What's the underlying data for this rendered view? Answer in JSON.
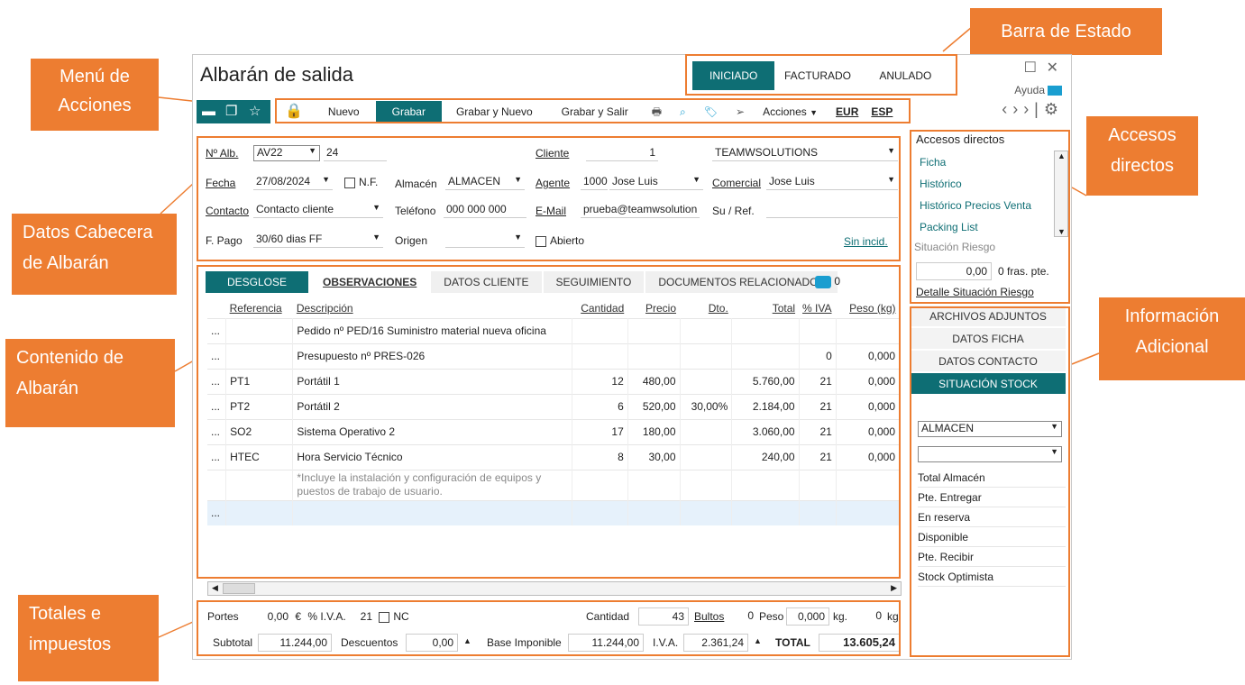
{
  "callouts": {
    "status_bar": "Barra de Estado",
    "actions_menu": "Menú de Acciones",
    "header_data": "Datos Cabecera de Albarán",
    "content": "Contenido de Albarán",
    "totals": "Totales e impuestos",
    "shortcuts": "Accesos directos",
    "extra_info": "Información Adicional"
  },
  "window": {
    "title": "Albarán de salida",
    "help": "Ayuda",
    "minimize": "☐",
    "close": "✕"
  },
  "status": {
    "items": [
      "INICIADO",
      "FACTURADO",
      "ANULADO"
    ]
  },
  "actions": {
    "nuevo": "Nuevo",
    "grabar": "Grabar",
    "grabar_nuevo": "Grabar y Nuevo",
    "grabar_salir": "Grabar y Salir",
    "acciones": "Acciones",
    "currency": "EUR",
    "lang": "ESP"
  },
  "header": {
    "albaran_label": "Nº Alb.",
    "serie": "AV22",
    "numero": "24",
    "fecha_label": "Fecha",
    "fecha": "27/08/2024",
    "nf_label": "N.F.",
    "almacen_label": "Almacén",
    "almacen": "ALMACEN",
    "contacto_label": "Contacto",
    "contacto": "Contacto cliente",
    "telefono_label": "Teléfono",
    "telefono": "000 000 000",
    "fpago_label": "F. Pago",
    "fpago": "30/60 dias FF",
    "origen_label": "Origen",
    "cliente_label": "Cliente",
    "cliente_code": "1",
    "cliente_name": "TEAMWSOLUTIONS",
    "agente_label": "Agente",
    "agente_code": "1000",
    "agente_name": "Jose Luis",
    "comercial_label": "Comercial",
    "comercial_name": "Jose Luis",
    "email_label": "E-Mail",
    "email": "prueba@teamwsolution",
    "suref_label": "Su / Ref.",
    "abierto_label": "Abierto",
    "sin_incid": "Sin incid."
  },
  "tabs": [
    "DESGLOSE",
    "OBSERVACIONES",
    "DATOS CLIENTE",
    "SEGUIMIENTO",
    "DOCUMENTOS RELACIONADOS"
  ],
  "comments_count": "0",
  "grid": {
    "columns": [
      "Referencia",
      "Descripción",
      "Cantidad",
      "Precio",
      "Dto.",
      "Total",
      "% IVA",
      "Peso (kg)"
    ],
    "rows": [
      {
        "ref": "",
        "desc": "Pedido nº PED/16 Suministro material nueva oficina",
        "qty": "",
        "price": "",
        "dto": "",
        "total": "",
        "iva": "",
        "peso": ""
      },
      {
        "ref": "",
        "desc": "Presupuesto nº PRES-026",
        "qty": "",
        "price": "",
        "dto": "",
        "total": "",
        "iva": "0",
        "peso": "0,000"
      },
      {
        "ref": "PT1",
        "desc": "Portátil 1",
        "qty": "12",
        "price": "480,00",
        "dto": "",
        "total": "5.760,00",
        "iva": "21",
        "peso": "0,000"
      },
      {
        "ref": "PT2",
        "desc": "Portátil 2",
        "qty": "6",
        "price": "520,00",
        "dto": "30,00%",
        "total": "2.184,00",
        "iva": "21",
        "peso": "0,000"
      },
      {
        "ref": "SO2",
        "desc": "Sistema Operativo 2",
        "qty": "17",
        "price": "180,00",
        "dto": "",
        "total": "3.060,00",
        "iva": "21",
        "peso": "0,000"
      },
      {
        "ref": "HTEC",
        "desc": "Hora Servicio Técnico",
        "qty": "8",
        "price": "30,00",
        "dto": "",
        "total": "240,00",
        "iva": "21",
        "peso": "0,000"
      }
    ],
    "note_line1": "*Incluye la instalación y configuración de equipos y",
    "note_line2": "puestos de trabajo de usuario.",
    "row_marker": "..."
  },
  "totals": {
    "portes_label": "Portes",
    "portes": "0,00",
    "portes_unit": "€",
    "iva_label": "% I.V.A.",
    "iva_pct": "21",
    "nc_label": "NC",
    "cantidad_label": "Cantidad",
    "cantidad": "43",
    "bultos_label": "Bultos",
    "bultos": "0",
    "peso_label": "Peso",
    "peso": "0,000",
    "kg": "kg.",
    "peso2": "0",
    "kg2": "kg.",
    "subtotal_label": "Subtotal",
    "subtotal": "11.244,00",
    "descuentos_label": "Descuentos",
    "descuentos": "0,00",
    "base_label": "Base Imponible",
    "base": "11.244,00",
    "iva_amount_label": "I.V.A.",
    "iva_amount": "2.361,24",
    "total_label": "TOTAL",
    "total": "13.605,24"
  },
  "sidebar": {
    "shortcuts_title": "Accesos directos",
    "shortcuts": [
      "Ficha",
      "Histórico",
      "Histórico Precios Venta",
      "Packing List"
    ],
    "riesgo_title": "Situación Riesgo",
    "riesgo_value": "0,00",
    "riesgo_fras": "0 fras. pte.",
    "riesgo_link": "Detalle Situación Riesgo",
    "buttons": [
      "ARCHIVOS ADJUNTOS",
      "DATOS FICHA",
      "DATOS CONTACTO",
      "SITUACIÓN STOCK"
    ],
    "almacen": "ALMACEN",
    "stock_rows": [
      "Total Almacén",
      "Pte. Entregar",
      "En reserva",
      "Disponible",
      "Pte. Recibir",
      "Stock Optimista"
    ]
  },
  "colors": {
    "accent": "#0E6E74",
    "callout": "#ED7D31"
  }
}
